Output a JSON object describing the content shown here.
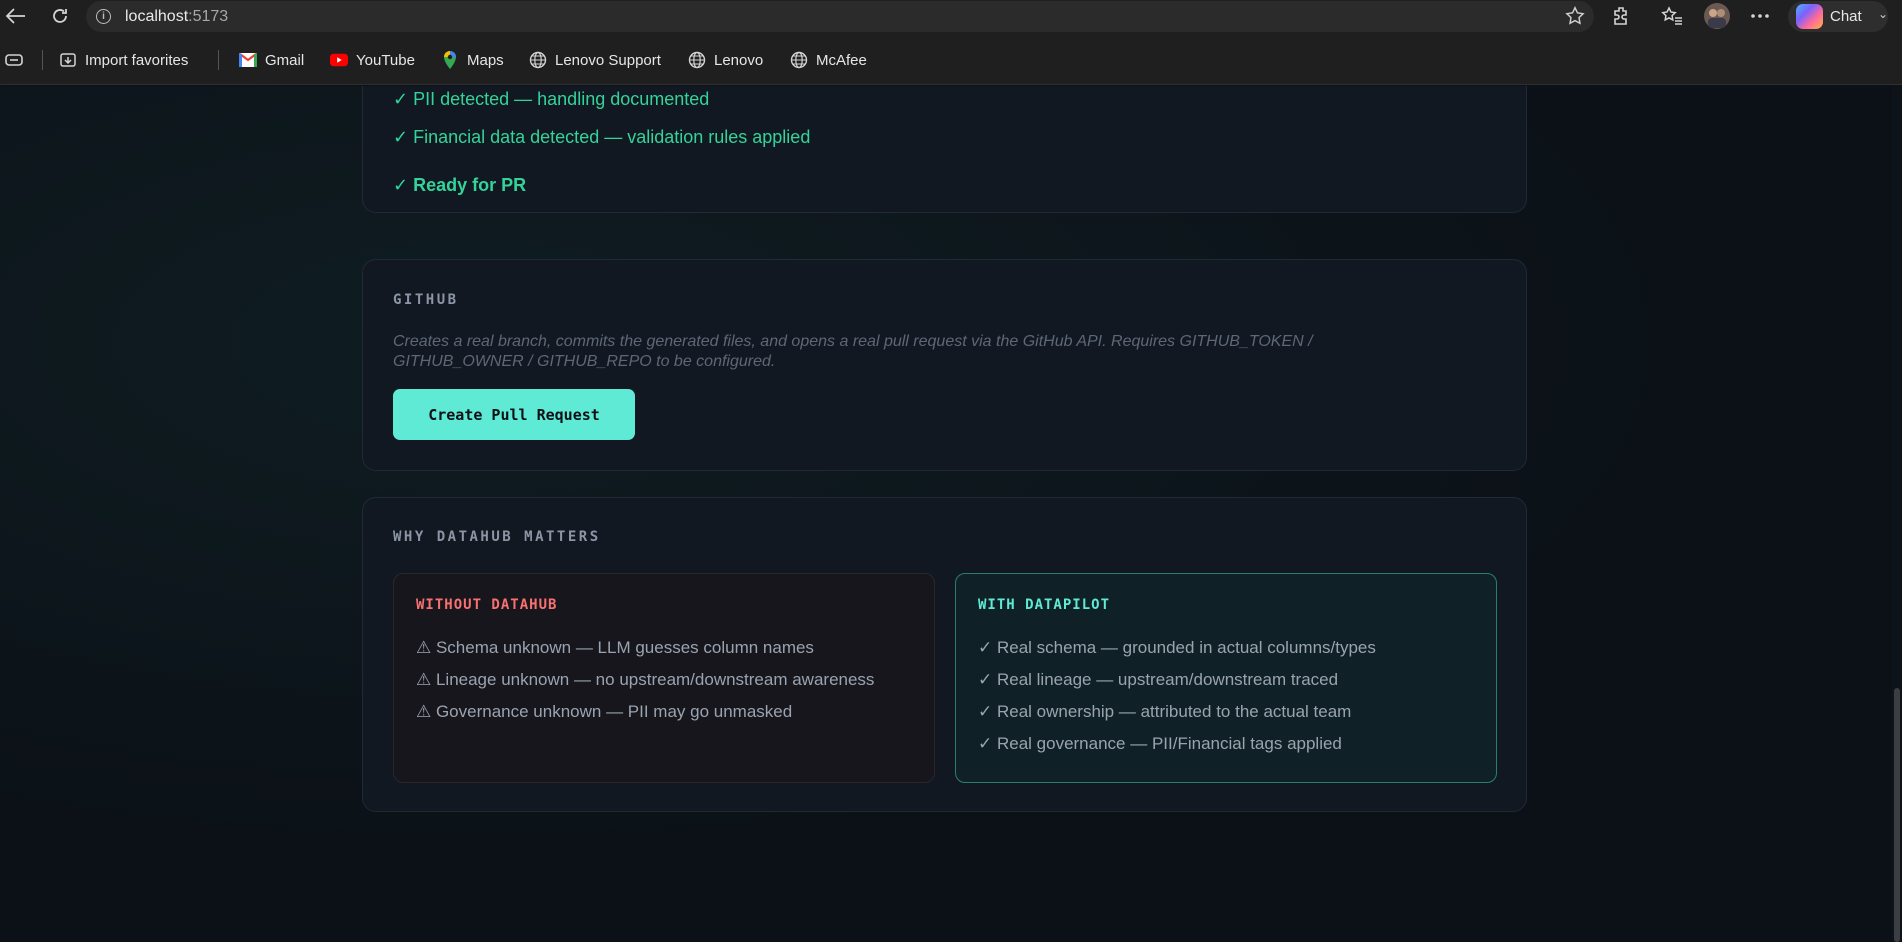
{
  "browser": {
    "url_host": "localhost",
    "url_port": ":5173",
    "chat_label": "Chat",
    "bookmarks": [
      {
        "label": "Import favorites",
        "icon": "import-favorites-icon"
      },
      {
        "label": "Gmail",
        "icon": "gmail-icon"
      },
      {
        "label": "YouTube",
        "icon": "youtube-icon"
      },
      {
        "label": "Maps",
        "icon": "maps-icon"
      },
      {
        "label": "Lenovo Support",
        "icon": "globe-icon"
      },
      {
        "label": "Lenovo",
        "icon": "globe-icon"
      },
      {
        "label": "McAfee",
        "icon": "globe-icon"
      }
    ]
  },
  "validation": {
    "items": [
      "✓ PII detected — handling documented",
      "✓ Financial data detected — validation rules applied"
    ],
    "ready": "✓ Ready for PR"
  },
  "github": {
    "title": "GITHUB",
    "description": "Creates a real branch, commits the generated files, and opens a real pull request via the GitHub API. Requires GITHUB_TOKEN / GITHUB_OWNER / GITHUB_REPO to be configured.",
    "button_label": "Create Pull Request"
  },
  "why": {
    "title": "WHY DATAHUB MATTERS",
    "without": {
      "title": "WITHOUT DATAHUB",
      "items": [
        "⚠ Schema unknown — LLM guesses column names",
        "⚠ Lineage unknown — no upstream/downstream awareness",
        "⚠ Governance unknown — PII may go unmasked"
      ]
    },
    "with": {
      "title": "WITH DATAPILOT",
      "items": [
        "✓ Real schema — grounded in actual columns/types",
        "✓ Real lineage — upstream/downstream traced",
        "✓ Real ownership — attributed to the actual team",
        "✓ Real governance — PII/Financial tags applied"
      ]
    }
  },
  "colors": {
    "accent": "#5eead4",
    "success": "#34d399",
    "danger": "#f87171",
    "background": "#0b1117",
    "card": "#111821"
  }
}
